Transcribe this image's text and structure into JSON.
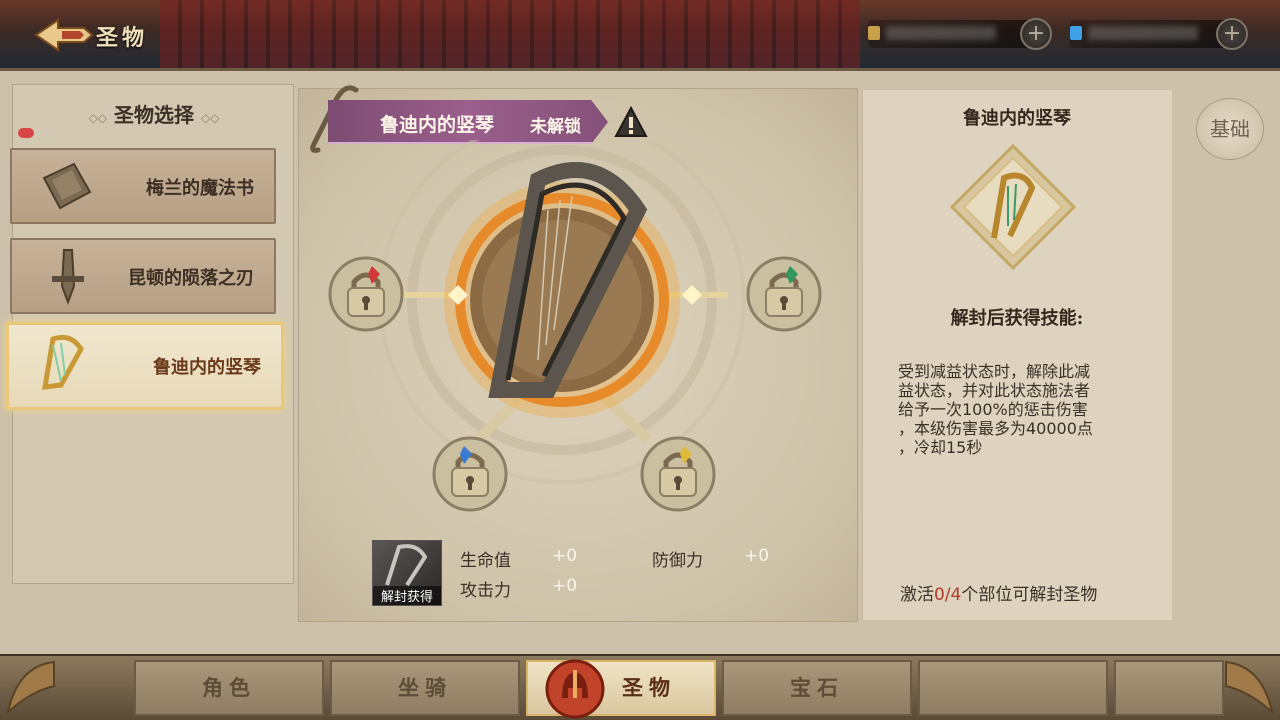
{
  "header": {
    "title": "圣物",
    "back_icon": "arrow-left-icon"
  },
  "left_panel": {
    "title": "圣物选择",
    "items": [
      {
        "label": "梅兰的魔法书",
        "icon": "magic-book-icon"
      },
      {
        "label": "昆顿的陨落之刃",
        "icon": "fallen-blade-icon"
      },
      {
        "label": "鲁迪内的竖琴",
        "icon": "harp-icon",
        "selected": true
      }
    ]
  },
  "center": {
    "relic_name": "鲁迪内的竖琴",
    "status": "未解锁",
    "thumb_label": "解封获得",
    "stats": [
      {
        "label": "生命值",
        "value": "+0"
      },
      {
        "label": "防御力",
        "value": "+0"
      },
      {
        "label": "攻击力",
        "value": "+0"
      }
    ]
  },
  "right_panel": {
    "title": "鲁迪内的竖琴",
    "skill_heading": "解封后获得技能:",
    "skill_desc": "受到减益状态时，解除此减\n益状态，并对此状态施法者\n给予一次100%的惩击伤害\n，本级伤害最多为40000点\n，冷却15秒",
    "progress_prefix": "激活",
    "progress_count": "0/4",
    "progress_suffix": "个部位可解封圣物"
  },
  "side_tab": {
    "label": "基础"
  },
  "bottom_nav": {
    "tabs": [
      {
        "label": "角色"
      },
      {
        "label": "坐骑"
      },
      {
        "label": "圣物",
        "active": true
      },
      {
        "label": "宝石"
      },
      {
        "label": ""
      },
      {
        "label": ""
      }
    ]
  },
  "colors": {
    "banner": "#9a5f8c",
    "selected_border": "#e8c778",
    "highlight_red": "#b33b2a",
    "gem_red": "#d23a3a",
    "gem_green": "#2f9a5a",
    "gem_blue": "#3a7ad2",
    "gem_yellow": "#e0b83a"
  }
}
